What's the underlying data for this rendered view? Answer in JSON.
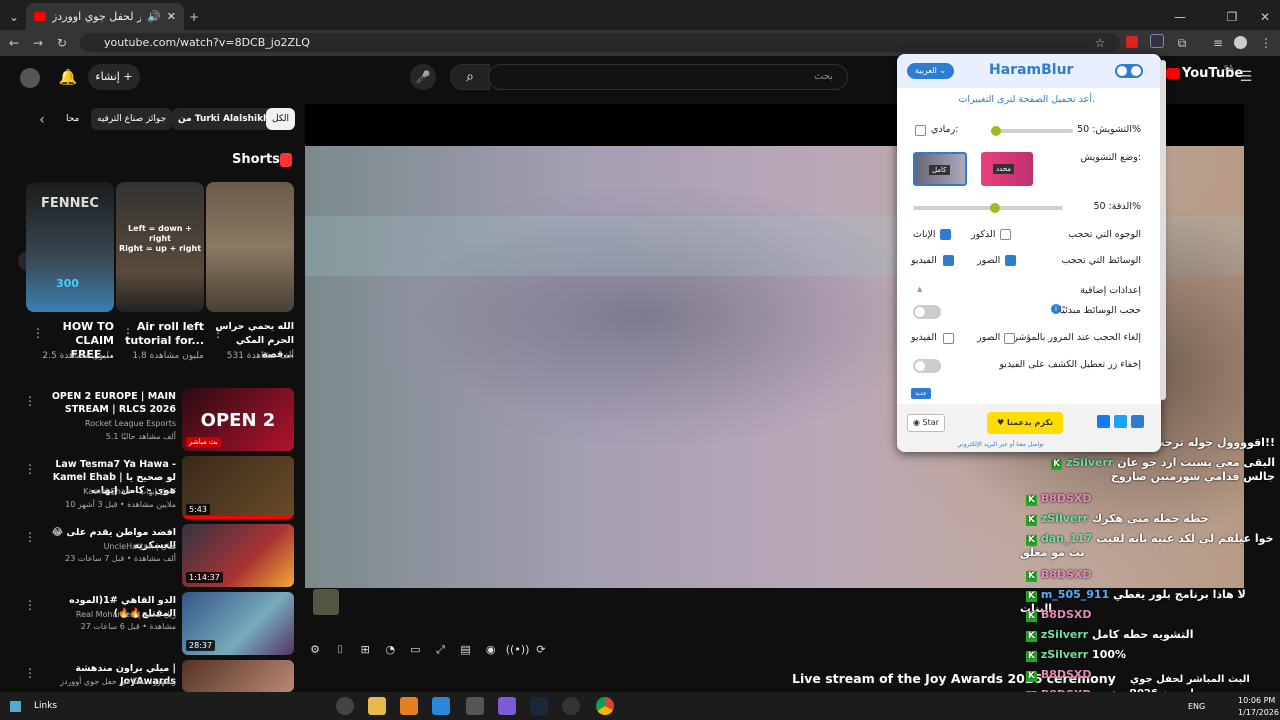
{
  "browser": {
    "tab_title": "البث المباشر لحفل جوي اووردز",
    "url": "youtube.com/watch?v=8DCB_jo2ZLQ"
  },
  "yt": {
    "create_label": "إنشاء",
    "search_placeholder": "بحث",
    "logo": "YouTube",
    "logo_region": "SA",
    "chips": [
      "الكل",
      "من Turki Alalshikh",
      "جوائز صناع الترفيه",
      "محا"
    ],
    "shorts_title": "Shorts",
    "shorts": [
      {
        "title": "HOW TO CLAIM FREE...",
        "views": "2.5 مليون مشاهدة",
        "thumb_text": "FENNEC",
        "thumb_sub": "300"
      },
      {
        "title": "Air roll left tutorial for...",
        "views": "1.8 مليون مشاهدة",
        "thumb_text": "Left = down + right\nRight = up + right"
      },
      {
        "title": "الله يحمي حراس الحرم المكي قصة...",
        "views": "531 ألف مشاهدة"
      }
    ],
    "videos": [
      {
        "title": "OPEN 2 EUROPE | MAIN STREAM | RLCS 2026",
        "channel": "Rocket League Esports",
        "meta": "5.1 ألف مشاهد حاليًا",
        "badge": "بث مباشر",
        "thumb": "OPEN 2"
      },
      {
        "title": "Law Tesma7 Ya Hawa - Kamel Ehab | لو صحيح يا هوى - كامل إيهاب",
        "channel": "Kamel Ehab - كامل إيهاب",
        "meta": "10 ملايين مشاهدة • قبل 3 أشهر",
        "dur": "5:43"
      },
      {
        "title": "😂 افضد مواطن يقدم على العسكريه",
        "channel": "UncleHattan | هتان",
        "meta": "23 ألف مشاهدة • قبل 7 ساعات",
        "dur": "1:14:37",
        "badge2": "جديد"
      },
      {
        "title": "الدو القاهي #1(الموده المقتلع🔥🔥)",
        "channel": "Real Mohamed | ريل محمد",
        "meta": "27 مشاهدة • قبل 6 ساعات",
        "dur": "28:37",
        "badge2": "جديد"
      },
      {
        "title": "ميلي براون مندهشة | JoyAwards",
        "channel": "وبجهورة تماثًا في حفل جوي أووردز",
        "meta": "ميلي براون تنهر"
      }
    ],
    "video_title": "Live stream of the Joy Awards 2026 ceremony"
  },
  "chat": [
    {
      "user": "witr_25",
      "msg": "اقوووول جوله ترحب فيني!!",
      "c": "cn",
      "k": true
    },
    {
      "user": "zSilverr",
      "msg": "البقى معي يسبت ارد جو عان جالس قدامي شورمتين صاروخ",
      "c": "cn",
      "k": true
    },
    {
      "user": "B8DSXD",
      "msg": "",
      "c": "cp",
      "k": true
    },
    {
      "user": "zSilverr",
      "msg": "حطه حمله مني هكرك",
      "c": "cn",
      "k": true
    },
    {
      "user": "dan_117",
      "msg": "خوا عيلفم لي لكد عنيه بانه لقيت بث مو معلق",
      "c": "cn",
      "k": true
    },
    {
      "user": "B8DSXD",
      "msg": "",
      "c": "cp",
      "k": true
    },
    {
      "user": "m_505_911",
      "msg": "لا هاذا برنامج بلور يغطي البنات",
      "c": "cb",
      "k": true
    },
    {
      "user": "B8DSXD",
      "msg": "",
      "c": "cp",
      "k": true
    },
    {
      "user": "zSilverr",
      "msg": "التشويه حطه كامل",
      "c": "cn",
      "k": true
    },
    {
      "user": "zSilverr",
      "msg": "100%",
      "c": "cn",
      "k": true
    },
    {
      "user": "B8DSXD",
      "msg": "",
      "c": "cp",
      "k": true
    },
    {
      "user": "B8DSXD",
      "msg": "الصفحة",
      "c": "cp",
      "k": true
    }
  ],
  "overlay_chat": "البث المباشر لحفل جوي اووردز 2026",
  "ext": {
    "title": "HaramBlur",
    "lang": "العربية",
    "reload": "أعد تحميل الصفحة لترى التغييرات.",
    "blur_label": "التشويش: 50%",
    "blur_value": 0.5,
    "gray_label": "رمادي:",
    "mode_label": "وضع التشويش:",
    "mode_full": "كامل",
    "mode_selective": "محدد",
    "accuracy_label": "الدقة: 50%",
    "accuracy_value": 0.5,
    "faces_label": "الوجوه التي تحجب",
    "males": "الذكور",
    "females": "الإناث",
    "media_label": "الوسائط التي تحجب",
    "images": "الصور",
    "videos": "الفيديو",
    "extra": "إعدادات إضافية",
    "hide_default": "حجب الوسائط مبدئيًا",
    "unblur_hover": "إلغاء الحجب عند المرور بالمؤشر",
    "images2": "الصور",
    "videos2": "الفيديو",
    "hide_button": "إخفاء زر تعطيل الكشف على الفيديو",
    "new_badge": "جديد",
    "donate": "تكرم بدعمنا",
    "star": "Star",
    "footer": "تواصل معنا أو عبر البريد الإلكتروني"
  },
  "taskbar": {
    "start": "Links",
    "time": "10:06 PM",
    "date": "1/17/2026",
    "lang": "ENG"
  }
}
